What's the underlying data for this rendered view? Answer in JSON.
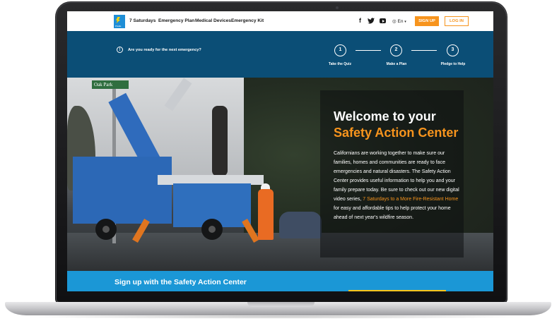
{
  "nav": {
    "links": [
      "7 Saturdays",
      "Emergency Plan",
      "Medical Devices",
      "Emergency Kit"
    ],
    "social_icons": [
      "facebook-icon",
      "twitter-icon",
      "youtube-icon"
    ],
    "language": "En",
    "signup_label": "SIGN UP",
    "login_label": "LOG IN"
  },
  "banner": {
    "question": "Are you ready for the next emergency?",
    "steps": [
      {
        "number": "1",
        "label": "Take the Quiz"
      },
      {
        "number": "2",
        "label": "Make a Plan"
      },
      {
        "number": "3",
        "label": "Pledge to Help"
      }
    ]
  },
  "hero": {
    "street_sign": "Oak Park",
    "title_line1": "Welcome to your",
    "title_line2": "Safety Action Center",
    "body_part1": "Californians are working together to make sure our families, homes and communities are ready to face emergencies and natural disasters. The Safety Action Center provides useful information to help you and your family prepare today. Be sure to check out our new digital video series, ",
    "body_link": "7 Saturdays to a More Fire-Resistant Home",
    "body_part2": " for easy and affordable tips to help protect your home ahead of next year's wildfire season."
  },
  "signup_section": {
    "heading": "Sign up with the Safety Action Center"
  },
  "colors": {
    "banner_blue": "#0b4e76",
    "accent_orange": "#f7941d",
    "signup_blue": "#1b97d6"
  }
}
